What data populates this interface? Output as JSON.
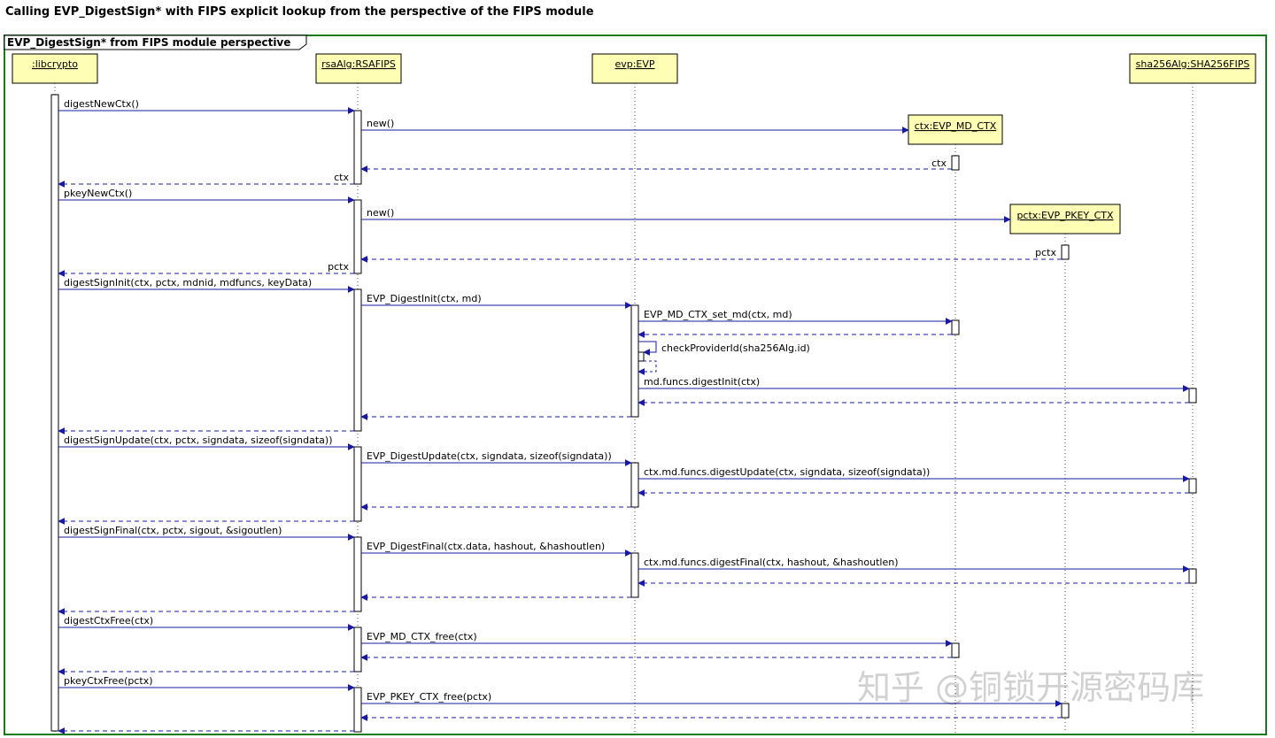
{
  "title": "Calling EVP_DigestSign* with FIPS explicit lookup from the perspective of the FIPS module",
  "frame_title": "EVP_DigestSign* from FIPS module perspective",
  "colors": {
    "frame": "#1a7a1a",
    "participant_fill": "#fefeb4",
    "arrow": "#1a1aa0",
    "lifeline": "#444444"
  },
  "participants": [
    {
      "id": "libcrypto",
      "label": ":libcrypto"
    },
    {
      "id": "rsa",
      "label": "rsaAlg:RSAFIPS"
    },
    {
      "id": "evp",
      "label": "evp:EVP"
    },
    {
      "id": "ctx",
      "label": "ctx:EVP_MD_CTX"
    },
    {
      "id": "pctx",
      "label": "pctx:EVP_PKEY_CTX"
    },
    {
      "id": "sha",
      "label": "sha256Alg:SHA256FIPS"
    }
  ],
  "messages": [
    {
      "from": "libcrypto",
      "to": "rsa",
      "label": "digestNewCtx()",
      "type": "call"
    },
    {
      "from": "rsa",
      "to": "ctx",
      "label": "new()",
      "type": "create"
    },
    {
      "from": "ctx",
      "to": "rsa",
      "label": "ctx",
      "type": "return"
    },
    {
      "from": "rsa",
      "to": "libcrypto",
      "label": "ctx",
      "type": "return"
    },
    {
      "from": "libcrypto",
      "to": "rsa",
      "label": "pkeyNewCtx()",
      "type": "call"
    },
    {
      "from": "rsa",
      "to": "pctx",
      "label": "new()",
      "type": "create"
    },
    {
      "from": "pctx",
      "to": "rsa",
      "label": "pctx",
      "type": "return"
    },
    {
      "from": "rsa",
      "to": "libcrypto",
      "label": "pctx",
      "type": "return"
    },
    {
      "from": "libcrypto",
      "to": "rsa",
      "label": "digestSignInit(ctx, pctx, mdnid, mdfuncs, keyData)",
      "type": "call"
    },
    {
      "from": "rsa",
      "to": "evp",
      "label": "EVP_DigestInit(ctx, md)",
      "type": "call"
    },
    {
      "from": "evp",
      "to": "ctx",
      "label": "EVP_MD_CTX_set_md(ctx, md)",
      "type": "call"
    },
    {
      "from": "ctx",
      "to": "evp",
      "label": "",
      "type": "return"
    },
    {
      "from": "evp",
      "to": "evp",
      "label": "checkProviderId(sha256Alg.id)",
      "type": "self"
    },
    {
      "from": "evp",
      "to": "sha",
      "label": "md.funcs.digestInit(ctx)",
      "type": "call"
    },
    {
      "from": "sha",
      "to": "evp",
      "label": "",
      "type": "return"
    },
    {
      "from": "evp",
      "to": "rsa",
      "label": "",
      "type": "return"
    },
    {
      "from": "rsa",
      "to": "libcrypto",
      "label": "",
      "type": "return"
    },
    {
      "from": "libcrypto",
      "to": "rsa",
      "label": "digestSignUpdate(ctx, pctx, signdata, sizeof(signdata))",
      "type": "call"
    },
    {
      "from": "rsa",
      "to": "evp",
      "label": "EVP_DigestUpdate(ctx, signdata, sizeof(signdata))",
      "type": "call"
    },
    {
      "from": "evp",
      "to": "sha",
      "label": "ctx.md.funcs.digestUpdate(ctx, signdata, sizeof(signdata))",
      "type": "call"
    },
    {
      "from": "sha",
      "to": "evp",
      "label": "",
      "type": "return"
    },
    {
      "from": "evp",
      "to": "rsa",
      "label": "",
      "type": "return"
    },
    {
      "from": "rsa",
      "to": "libcrypto",
      "label": "",
      "type": "return"
    },
    {
      "from": "libcrypto",
      "to": "rsa",
      "label": "digestSignFinal(ctx, pctx, sigout, &sigoutlen)",
      "type": "call"
    },
    {
      "from": "rsa",
      "to": "evp",
      "label": "EVP_DigestFinal(ctx.data, hashout, &hashoutlen)",
      "type": "call"
    },
    {
      "from": "evp",
      "to": "sha",
      "label": "ctx.md.funcs.digestFinal(ctx, hashout, &hashoutlen)",
      "type": "call"
    },
    {
      "from": "sha",
      "to": "evp",
      "label": "",
      "type": "return"
    },
    {
      "from": "evp",
      "to": "rsa",
      "label": "",
      "type": "return"
    },
    {
      "from": "rsa",
      "to": "libcrypto",
      "label": "",
      "type": "return"
    },
    {
      "from": "libcrypto",
      "to": "rsa",
      "label": "digestCtxFree(ctx)",
      "type": "call"
    },
    {
      "from": "rsa",
      "to": "ctx",
      "label": "EVP_MD_CTX_free(ctx)",
      "type": "call"
    },
    {
      "from": "ctx",
      "to": "rsa",
      "label": "",
      "type": "return"
    },
    {
      "from": "rsa",
      "to": "libcrypto",
      "label": "",
      "type": "return"
    },
    {
      "from": "libcrypto",
      "to": "rsa",
      "label": "pkeyCtxFree(pctx)",
      "type": "call"
    },
    {
      "from": "rsa",
      "to": "pctx",
      "label": "EVP_PKEY_CTX_free(pctx)",
      "type": "call"
    },
    {
      "from": "pctx",
      "to": "rsa",
      "label": "",
      "type": "return"
    },
    {
      "from": "rsa",
      "to": "libcrypto",
      "label": "",
      "type": "return"
    }
  ],
  "watermark": "知乎 @铜锁开源密码库"
}
